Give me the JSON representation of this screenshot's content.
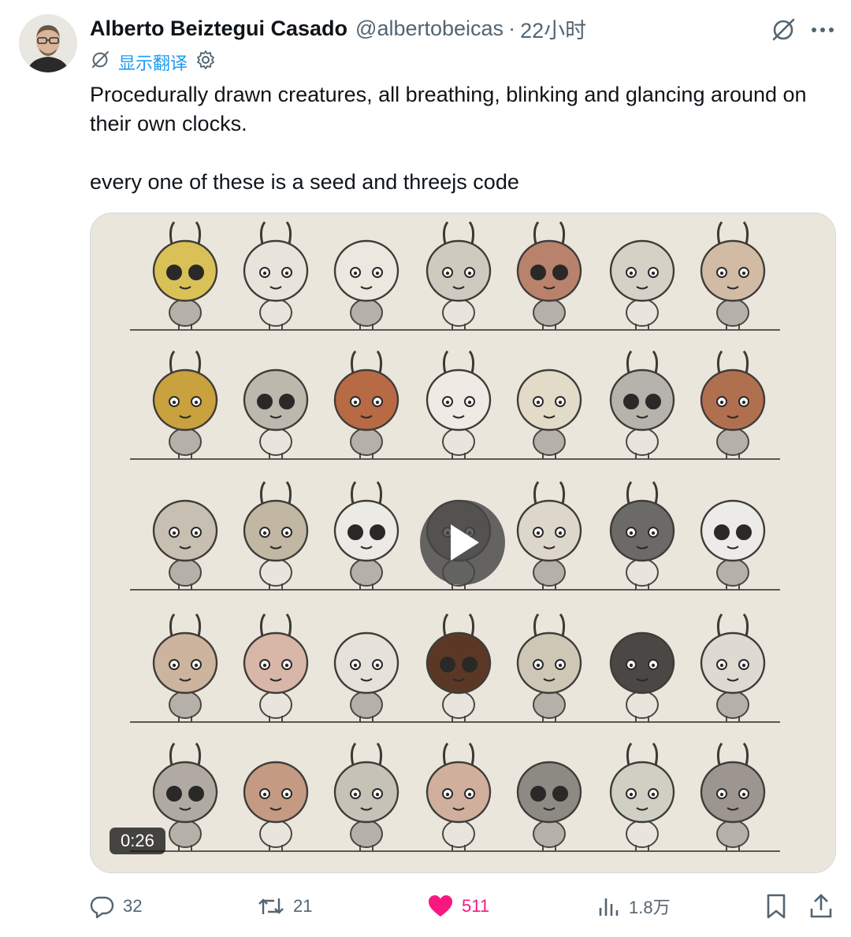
{
  "author": {
    "display_name": "Alberto Beiztegui Casado",
    "handle": "@albertobeicas",
    "separator": "·",
    "timestamp": "22小时"
  },
  "translate": {
    "label": "显示翻译"
  },
  "tweet": {
    "line1": "Procedurally drawn creatures, all breathing, blinking and glancing around on their own clocks.",
    "line2": "every one of these is a seed and threejs code"
  },
  "video": {
    "duration": "0:26"
  },
  "actions": {
    "replies": "32",
    "reposts": "21",
    "likes": "511",
    "views": "1.8万"
  },
  "colors": {
    "accent": "#1d9bf0",
    "like": "#f91880",
    "muted": "#536471"
  },
  "icons": [
    "grok-icon",
    "more-icon",
    "gear-icon",
    "reply-icon",
    "repost-icon",
    "heart-icon",
    "views-icon",
    "bookmark-icon",
    "share-icon",
    "play-icon"
  ]
}
